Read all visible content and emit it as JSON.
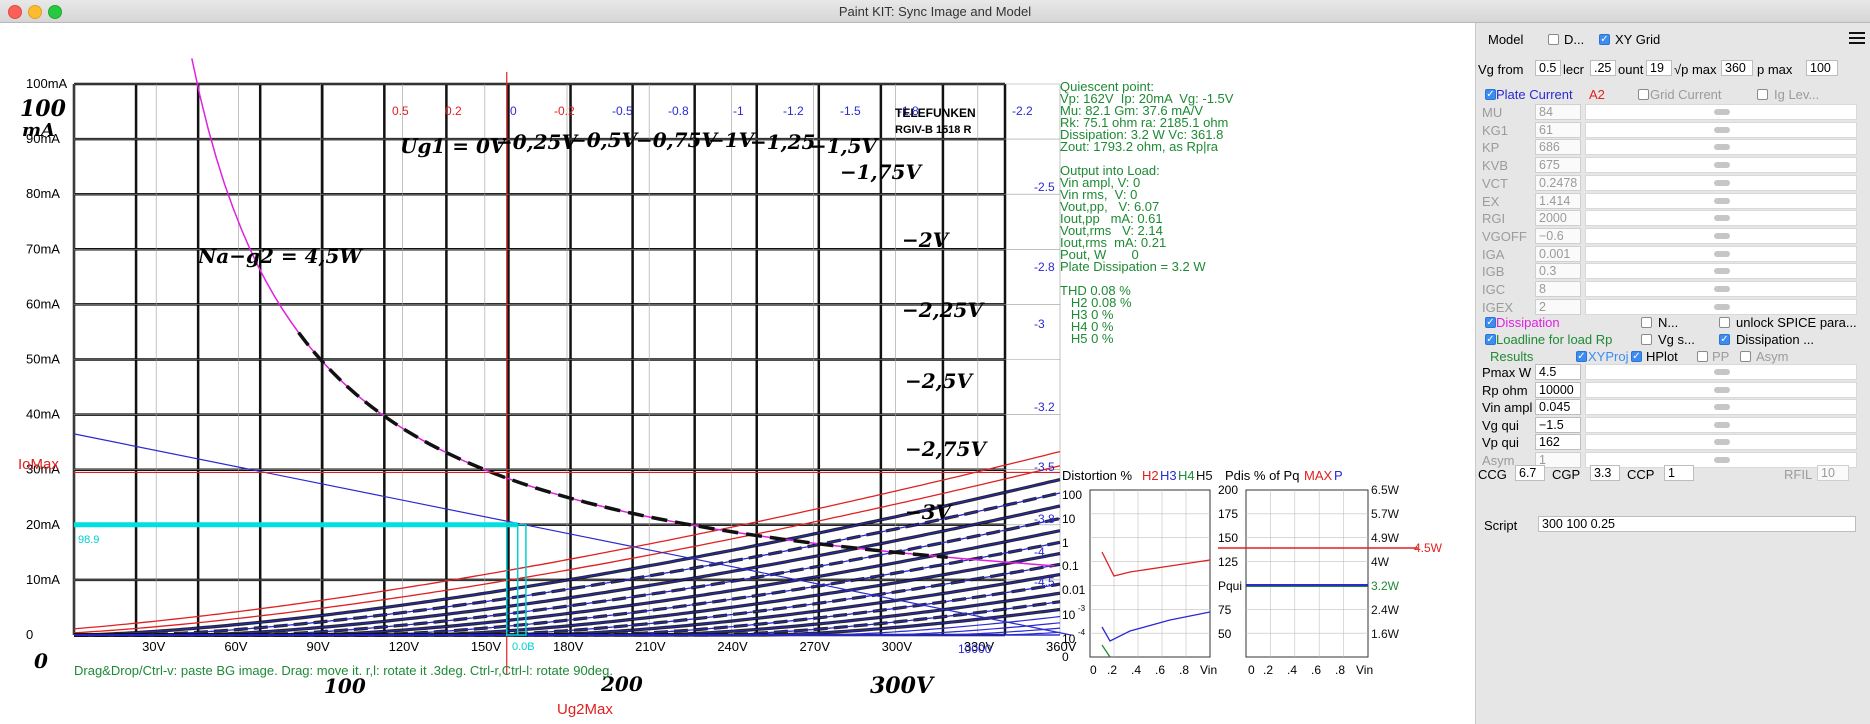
{
  "window": {
    "title": "Paint KIT: Sync Image and Model"
  },
  "plot": {
    "y_ticks": [
      "100mA",
      "90mA",
      "80mA",
      "70mA",
      "60mA",
      "50mA",
      "40mA",
      "30mA",
      "20mA",
      "10mA",
      "0"
    ],
    "x_ticks": [
      "30V",
      "60V",
      "90V",
      "120V",
      "150V",
      "180V",
      "210V",
      "240V",
      "270V",
      "300V",
      "330V",
      "360V"
    ],
    "top_labels": [
      {
        "text": "0.5",
        "color": "#e02020"
      },
      {
        "text": "0.2",
        "color": "#e02020"
      },
      {
        "text": "0",
        "color": "#2a2ad0"
      },
      {
        "text": "-0.2",
        "color": "#e02020"
      },
      {
        "text": "-0.5",
        "color": "#2a2ad0"
      },
      {
        "text": "-0.8",
        "color": "#2a2ad0"
      },
      {
        "text": "-1",
        "color": "#2a2ad0"
      },
      {
        "text": "-1.2",
        "color": "#2a2ad0"
      },
      {
        "text": "-1.5",
        "color": "#2a2ad0"
      },
      {
        "text": "-1.8",
        "color": "#2a2ad0"
      },
      {
        "text": "-2.2",
        "color": "#2a2ad0"
      }
    ],
    "right_labels": [
      "-2.5",
      "-2.8",
      "-3",
      "-3.2",
      "-3.5",
      "-3.8",
      "-4",
      "-4.5"
    ],
    "iomax_label": "IoMax",
    "ug2max_label": "Ug2Max",
    "cyan_value": "98.9",
    "cyan_bottom": "0.0B",
    "load_label": "10000",
    "bg_image_labels": {
      "y100": "100",
      "ymA": "mA",
      "x0": "0",
      "x100": "100",
      "x200": "200",
      "x300": "300V",
      "ug": "Ug1 = 0V",
      "ug025": "−0,25V",
      "ug05": "−0,5V",
      "ug075": "−0,75V",
      "ug1": "−1V",
      "ug125": "−1,25",
      "ug15": "−1,5V",
      "ug175": "−1,75V",
      "ug2": "−2V",
      "ug225": "−2,25V",
      "ug25": "−2,5V",
      "ug275": "−2,75V",
      "ug3": "−3V",
      "na": "Na−g2 = 4,5W",
      "brand": "TELEFUNKEN",
      "model": "RGIV-B 1518 R"
    },
    "status": "Drag&Drop/Ctrl-v: paste BG image. Drag: move it. r,l: rotate it .3deg. Ctrl-r,Ctrl-l: rotate 90deg."
  },
  "quiescent": [
    "Quiescent point:",
    "Vp: 162V  Ip: 20mA  Vg: -1.5V",
    "Mu: 82.1 Gm: 37.6 mA/V",
    "Rk: 75.1 ohm ra: 2185.1 ohm",
    "Dissipation: 3.2 W Vc: 361.8",
    "Zout: 1793.2 ohm, as Rp|ra",
    "",
    "Output into Load:",
    "Vin ampl, V: 0",
    "Vin rms,  V: 0",
    "Vout,pp,   V: 6.07",
    "Iout,pp   mA: 0.61",
    "Vout,rms   V: 2.14",
    "Iout,rms  mA: 0.21",
    "Pout, W       0",
    "Plate Dissipation = 3.2 W",
    "",
    "THD 0.08 %",
    "   H2 0.08 %",
    "   H3 0 %",
    "   H4 0 %",
    "   H5 0 %"
  ],
  "distortion": {
    "title": "Distortion %",
    "h2": "H2",
    "h3": "H3",
    "h4": "H4",
    "h5": "H5",
    "y_ticks": [
      "100",
      "10",
      "1",
      "0.1",
      "0.01",
      "10",
      "10",
      "0"
    ],
    "y_exp": [
      "-3",
      "-4"
    ],
    "x_ticks": [
      ".2",
      ".4",
      ".6",
      ".8"
    ],
    "x_zero": "0",
    "x_unit": "Vin"
  },
  "pdis": {
    "title": "Pdis % of Pq",
    "max": "MAX",
    "p": "P",
    "y_ticks": [
      "200",
      "175",
      "150",
      "125",
      "Pqui",
      "75",
      "50"
    ],
    "right_ticks": [
      "6.5W",
      "5.7W",
      "4.9W",
      "4W",
      "3.2W",
      "2.4W",
      "1.6W"
    ],
    "max_label": "4.5W",
    "x_ticks": [
      ".2",
      ".4",
      ".6",
      ".8"
    ],
    "x_zero": "0",
    "x_unit": "Vin"
  },
  "panel": {
    "model_label": "Model",
    "d_label": "D...",
    "xygrid_label": "XY Grid",
    "vgfrom_label": "Vg from",
    "vgfrom_value": "0.5",
    "decr_label": "lecr",
    "decr_value": ".25",
    "count_label": "ount",
    "count_value": "19",
    "vpmax_label": "√p max",
    "vpmax_value": "360",
    "ipmax_label": "p max",
    "ipmax_value": "100",
    "plate_current": "Plate Current",
    "a2": "A2",
    "grid_current": "Grid Current",
    "ig_lev": "Ig Lev...",
    "params": [
      {
        "name": "MU",
        "value": "84"
      },
      {
        "name": "KG1",
        "value": "61"
      },
      {
        "name": "KP",
        "value": "686"
      },
      {
        "name": "KVB",
        "value": "675"
      },
      {
        "name": "VCT",
        "value": "0.2478"
      },
      {
        "name": "EX",
        "value": "1.414"
      },
      {
        "name": "RGI",
        "value": "2000"
      },
      {
        "name": "VGOFF",
        "value": "−0.6"
      },
      {
        "name": "IGA",
        "value": "0.001"
      },
      {
        "name": "IGB",
        "value": "0.3"
      },
      {
        "name": "IGC",
        "value": "8"
      },
      {
        "name": "IGEX",
        "value": "2"
      }
    ],
    "dissipation": "Dissipation",
    "n_label": "N...",
    "unlock_label": "unlock SPICE para...",
    "loadline_label": "Loadline for load Rp",
    "vgs_label": "Vg s...",
    "dissipation2": "Dissipation ...",
    "results": "Results",
    "xyproj": "XYProj",
    "hplot": "HPlot",
    "pp": "PP",
    "asym_cb": "Asym",
    "params2": [
      {
        "name": "Pmax W",
        "value": "4.5"
      },
      {
        "name": "Rp ohm",
        "value": "10000"
      },
      {
        "name": "Vin ampl",
        "value": "0.045"
      },
      {
        "name": "Vg qui",
        "value": "−1.5"
      },
      {
        "name": "Vp qui",
        "value": "162"
      },
      {
        "name": "Asym",
        "value": "1"
      }
    ],
    "ccg_label": "CCG",
    "ccg_value": "6.7",
    "cgp_label": "CGP",
    "cgp_value": "3.3",
    "ccp_label": "CCP",
    "ccp_value": "1",
    "rfil_label": "RFIL",
    "rfil_value": "10",
    "script_label": "Script",
    "script_value": "300 100 0.25"
  }
}
